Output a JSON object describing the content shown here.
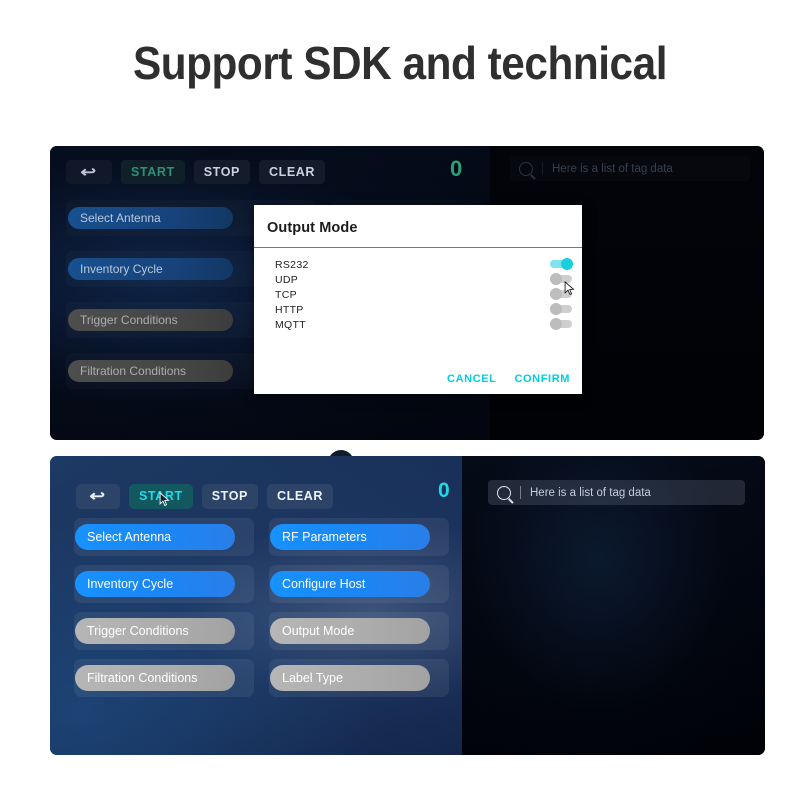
{
  "page": {
    "title": "Support SDK and technical"
  },
  "top_panel": {
    "toolbar": {
      "back_icon": "back-arrow-icon",
      "back_label": "↩",
      "start_label": "START",
      "stop_label": "STOP",
      "clear_label": "CLEAR",
      "counter": "0"
    },
    "menu_items": [
      {
        "label": "Select Antenna",
        "state": "blue"
      },
      {
        "label": "Inventory Cycle",
        "state": "blue"
      },
      {
        "label": "Trigger Conditions",
        "state": "gray"
      },
      {
        "label": "Filtration Conditions",
        "state": "gray"
      }
    ],
    "search": {
      "icon": "search-icon",
      "placeholder": "Here is a list of tag data",
      "value": ""
    }
  },
  "dialog": {
    "title": "Output Mode",
    "options": [
      {
        "label": "RS232",
        "enabled": true
      },
      {
        "label": "UDP",
        "enabled": false
      },
      {
        "label": "TCP",
        "enabled": false
      },
      {
        "label": "HTTP",
        "enabled": false
      },
      {
        "label": "MQTT",
        "enabled": false
      }
    ],
    "cancel_label": "CANCEL",
    "confirm_label": "CONFIRM",
    "cursor": "mouse-pointer-icon"
  },
  "bottom_panel": {
    "toolbar": {
      "back_icon": "back-arrow-icon",
      "back_label": "↩",
      "start_label": "START",
      "stop_label": "STOP",
      "clear_label": "CLEAR",
      "counter": "0"
    },
    "menu_left": [
      {
        "label": "Select Antenna",
        "state": "blue"
      },
      {
        "label": "Inventory Cycle",
        "state": "blue"
      },
      {
        "label": "Trigger Conditions",
        "state": "gray"
      },
      {
        "label": "Filtration Conditions",
        "state": "gray"
      }
    ],
    "menu_right": [
      {
        "label": "RF Parameters",
        "state": "blue"
      },
      {
        "label": "Configure Host",
        "state": "blue"
      },
      {
        "label": "Output Mode",
        "state": "gray"
      },
      {
        "label": "Label Type",
        "state": "gray"
      }
    ],
    "search": {
      "icon": "search-icon",
      "placeholder": "Here is a list of tag data",
      "value": ""
    },
    "cursor": "mouse-pointer-icon"
  },
  "colors": {
    "accent_cyan": "#1fd8e6",
    "accent_blue": "#1792ff",
    "toggle_on": "#19cedd",
    "counter_green": "#29a07a"
  }
}
